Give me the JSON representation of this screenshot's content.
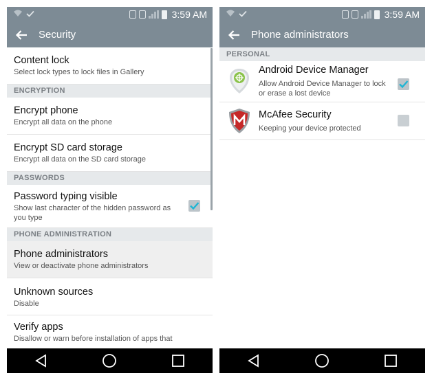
{
  "statusbar": {
    "time": "3:59 AM"
  },
  "left": {
    "title": "Security",
    "items": [
      {
        "kind": "item",
        "title": "Content lock",
        "subtitle": "Select lock types to lock files in Gallery"
      },
      {
        "kind": "section",
        "label": "ENCRYPTION"
      },
      {
        "kind": "item",
        "title": "Encrypt phone",
        "subtitle": "Encrypt all data on the phone"
      },
      {
        "kind": "item",
        "title": "Encrypt SD card storage",
        "subtitle": "Encrypt all data on the SD card storage"
      },
      {
        "kind": "section",
        "label": "PASSWORDS"
      },
      {
        "kind": "item",
        "title": "Password typing visible",
        "subtitle": "Show last character of the hidden password as you type",
        "checkbox": true,
        "checked": true
      },
      {
        "kind": "section",
        "label": "PHONE ADMINISTRATION"
      },
      {
        "kind": "item",
        "title": "Phone administrators",
        "subtitle": "View or deactivate phone administrators",
        "pressed": true
      },
      {
        "kind": "item",
        "title": "Unknown sources",
        "subtitle": "Disable"
      },
      {
        "kind": "item",
        "title": "Verify apps",
        "subtitle": "Disallow or warn before installation of apps that"
      }
    ]
  },
  "right": {
    "title": "Phone administrators",
    "section": "PERSONAL",
    "admins": [
      {
        "name": "Android Device Manager",
        "description": "Allow Android Device Manager to lock or erase a lost device",
        "checked": true,
        "icon": "android-device-manager-icon"
      },
      {
        "name": "McAfee Security",
        "description": "Keeping your device protected",
        "checked": false,
        "icon": "mcafee-shield-icon"
      }
    ]
  },
  "colors": {
    "bar": "#7d8b95",
    "section_bg": "#e6e9eb",
    "check": "#1fb5d4",
    "navbar": "#000000"
  }
}
